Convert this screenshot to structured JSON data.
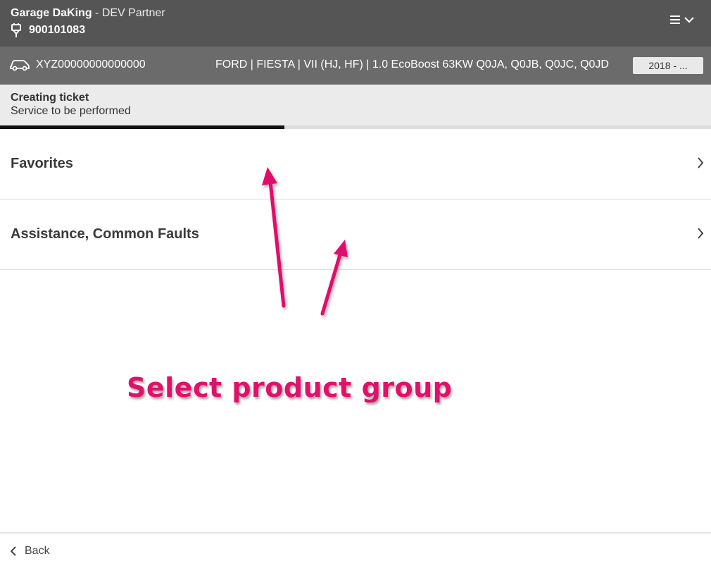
{
  "header": {
    "garage_name": "Garage DaKing",
    "separator": " - ",
    "partner": "DEV Partner",
    "customer_number": "900101083",
    "menu_icon": "hamburger-icon",
    "menu_chevron": "chevron-down-icon"
  },
  "vehicle": {
    "icon": "car-icon",
    "vin": "XYZ00000000000000",
    "description": "FORD | FIESTA | VII (HJ, HF) | 1.0 EcoBoost 63KW Q0JA, Q0JB, Q0JC, Q0JD",
    "year": "2018 - ..."
  },
  "ticket": {
    "title": "Creating ticket",
    "subtitle": "Service to be performed",
    "progress": 0.4
  },
  "list": {
    "items": [
      {
        "label": "Favorites"
      },
      {
        "label": "Assistance, Common Faults"
      }
    ]
  },
  "annotation": {
    "text": "Select product group",
    "color": "#e0106c"
  },
  "footer": {
    "back_label": "Back"
  },
  "colors": {
    "topbar": "#555555",
    "vehiclebar": "#6b6b6b",
    "ticketbar": "#ebebeb",
    "progress": "#111111"
  }
}
